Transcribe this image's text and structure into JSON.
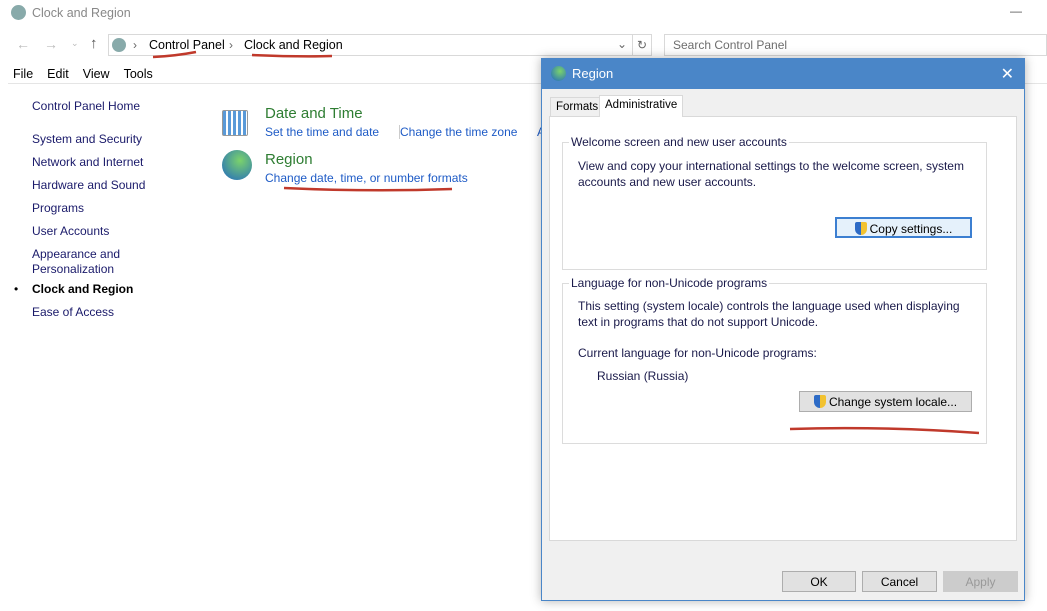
{
  "window": {
    "title": "Clock and Region"
  },
  "address": {
    "crumbs": [
      "Control Panel",
      "Clock and Region"
    ],
    "search_placeholder": "Search Control Panel"
  },
  "menu": [
    "File",
    "Edit",
    "View",
    "Tools"
  ],
  "sidebar": {
    "home": "Control Panel Home",
    "items": [
      "System and Security",
      "Network and Internet",
      "Hardware and Sound",
      "Programs",
      "User Accounts",
      "Appearance and Personalization",
      "Clock and Region",
      "Ease of Access"
    ]
  },
  "main": {
    "date_time": {
      "title": "Date and Time",
      "links": [
        "Set the time and date",
        "Change the time zone",
        "A"
      ]
    },
    "region": {
      "title": "Region",
      "link": "Change date, time, or number formats"
    }
  },
  "dialog": {
    "title": "Region",
    "tabs": [
      "Formats",
      "Administrative"
    ],
    "welcome": {
      "legend": "Welcome screen and new user accounts",
      "text": "View and copy your international settings to the welcome screen, system accounts and new user accounts.",
      "button": "Copy settings..."
    },
    "locale": {
      "legend": "Language for non-Unicode programs",
      "text": "This setting (system locale) controls the language used when displaying text in programs that do not support Unicode.",
      "current_label": "Current language for non-Unicode programs:",
      "current_value": "Russian (Russia)",
      "button": "Change system locale..."
    },
    "buttons": {
      "ok": "OK",
      "cancel": "Cancel",
      "apply": "Apply"
    }
  }
}
